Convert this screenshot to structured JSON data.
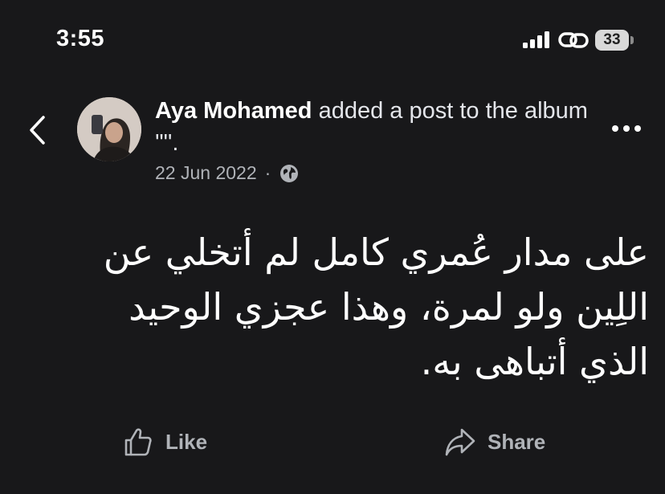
{
  "status_bar": {
    "time": "3:55",
    "battery": "33",
    "icons": [
      "signal-icon",
      "link-icon",
      "battery-icon"
    ]
  },
  "nav": {
    "back_icon": "chevron-left-icon",
    "more_icon": "ellipsis-icon"
  },
  "post": {
    "author": "Aya Mohamed",
    "action_text": " added a post to the album '\"'.",
    "date": "22 Jun 2022",
    "separator": "·",
    "privacy_icon": "globe-icon",
    "text": "على مدار عُمري كامل لم أتخلي عن اللِين ولو لمرة، وهذا عجزي الوحيد الذي أتباهى به."
  },
  "actions": {
    "like_label": "Like",
    "share_label": "Share"
  },
  "colors": {
    "background": "#18181a",
    "primary_text": "#ffffff",
    "secondary_text": "#b0b3b8"
  }
}
